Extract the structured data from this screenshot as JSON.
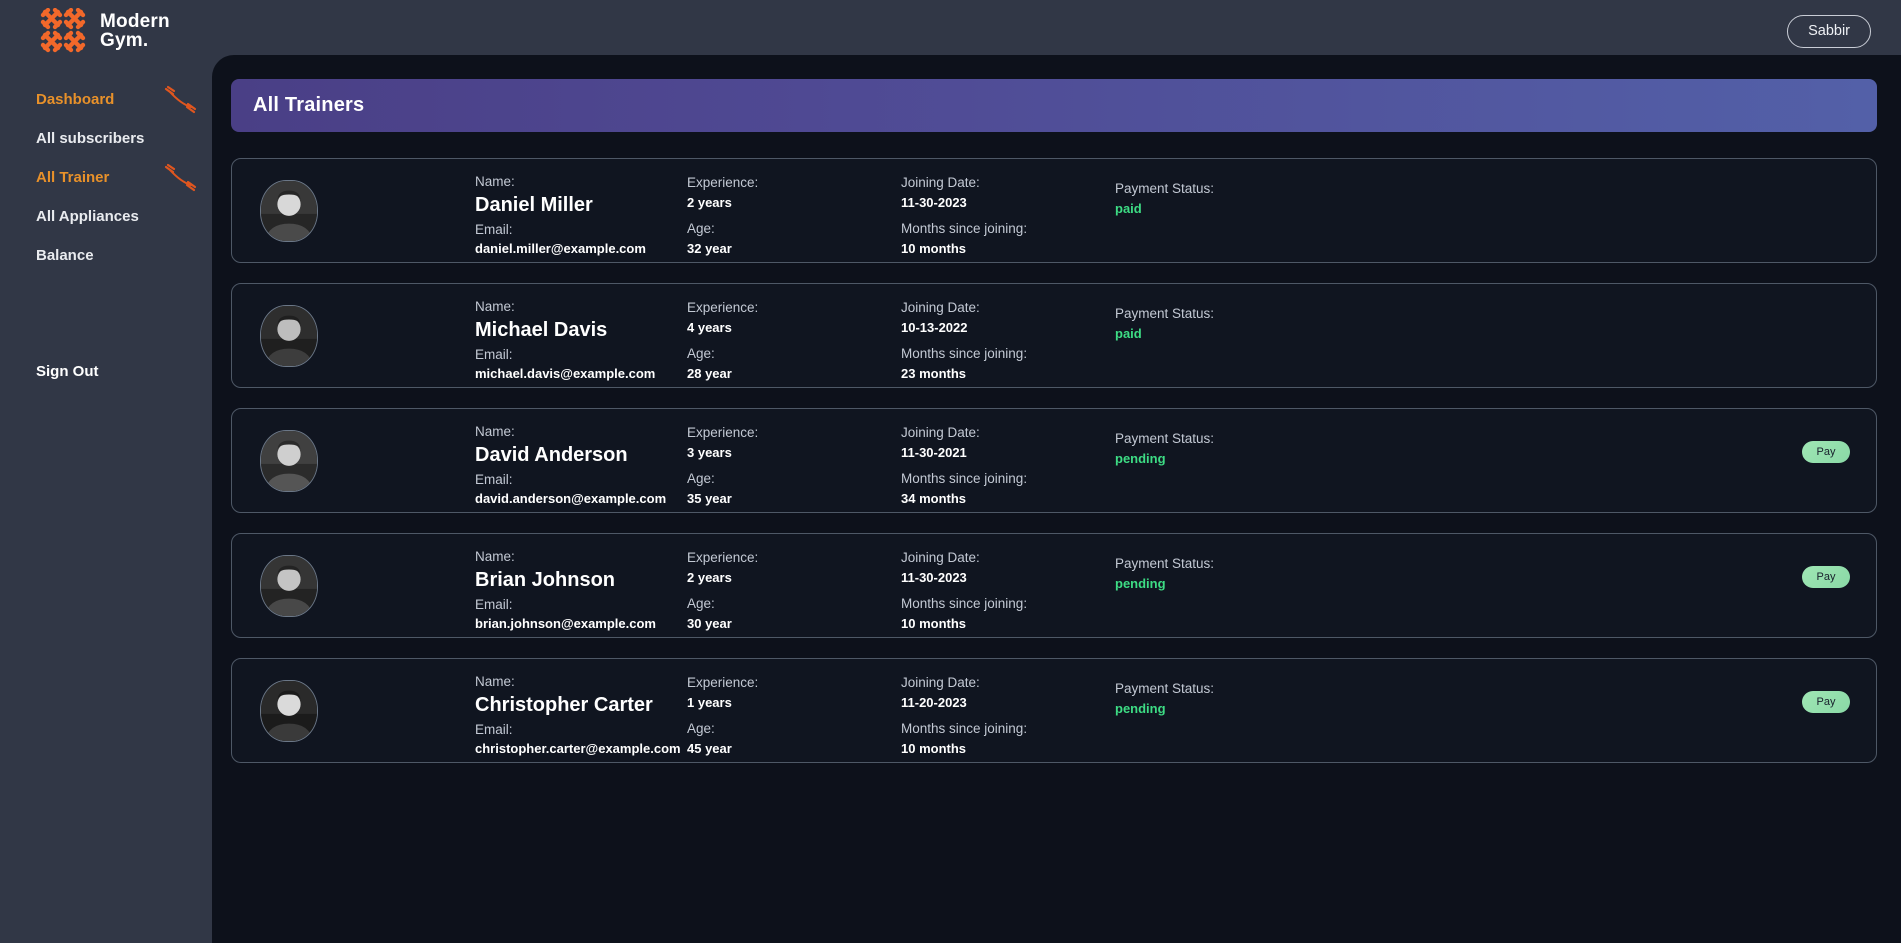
{
  "brand": {
    "line1": "Modern",
    "line2": "Gym.",
    "logo_icon": "dumbbell-cross-logo"
  },
  "header": {
    "user_label": "Sabbir"
  },
  "sidebar": {
    "items": [
      {
        "label": "Dashboard",
        "active": true,
        "icon": "dumbbell-icon"
      },
      {
        "label": "All subscribers",
        "active": false,
        "icon": ""
      },
      {
        "label": "All Trainer",
        "active": true,
        "icon": "dumbbell-icon"
      },
      {
        "label": "All Appliances",
        "active": false,
        "icon": ""
      },
      {
        "label": "Balance",
        "active": false,
        "icon": ""
      }
    ],
    "sign_out": "Sign Out"
  },
  "main": {
    "page_title": "All Trainers",
    "labels": {
      "name": "Name:",
      "email": "Email:",
      "experience": "Experience:",
      "age": "Age:",
      "joining_date": "Joining Date:",
      "months_since": "Months since joining:",
      "payment_status": "Payment Status:"
    },
    "pay_button_label": "Pay",
    "trainers": [
      {
        "name": "Daniel Miller",
        "email": "daniel.miller@example.com",
        "experience": "2 years",
        "age": "32 year",
        "joining_date": "11-30-2023",
        "months_since": "10 months",
        "payment_status": "paid",
        "show_pay": false
      },
      {
        "name": "Michael Davis",
        "email": "michael.davis@example.com",
        "experience": "4 years",
        "age": "28 year",
        "joining_date": "10-13-2022",
        "months_since": "23 months",
        "payment_status": "paid",
        "show_pay": false
      },
      {
        "name": "David Anderson",
        "email": "david.anderson@example.com",
        "experience": "3 years",
        "age": "35 year",
        "joining_date": "11-30-2021",
        "months_since": "34 months",
        "payment_status": "pending",
        "show_pay": true
      },
      {
        "name": "Brian Johnson",
        "email": "brian.johnson@example.com",
        "experience": "2 years",
        "age": "30 year",
        "joining_date": "11-30-2023",
        "months_since": "10 months",
        "payment_status": "pending",
        "show_pay": true
      },
      {
        "name": "Christopher Carter",
        "email": "christopher.carter@example.com",
        "experience": "1 years",
        "age": "45 year",
        "joining_date": "11-20-2023",
        "months_since": "10 months",
        "payment_status": "pending",
        "show_pay": true
      }
    ]
  },
  "colors": {
    "app_bg": "#313746",
    "panel_bg": "#0d111b",
    "card_bg": "#101520",
    "card_border": "#4e5866",
    "accent_orange": "#e8912a",
    "banner_from": "#4a3f86",
    "banner_to": "#5360a8",
    "status_green": "#3ddc84",
    "pay_btn": "#9fe6b4"
  }
}
